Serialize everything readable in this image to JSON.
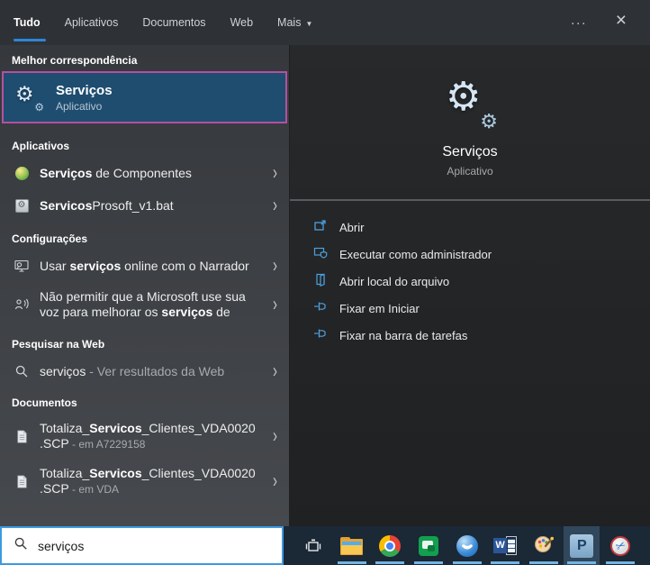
{
  "tabs": [
    {
      "label": "Tudo",
      "active": true
    },
    {
      "label": "Aplicativos",
      "active": false
    },
    {
      "label": "Documentos",
      "active": false
    },
    {
      "label": "Web",
      "active": false
    },
    {
      "label": "Mais",
      "active": false,
      "has_dropdown": true
    }
  ],
  "icons": {
    "gear": "⚙",
    "chevron": "›",
    "more": "···",
    "close": "×",
    "dropdown": "▼",
    "word_letter": "W",
    "prosoft_letter": "P",
    "scissors": "✂",
    "bat_gear": "⚙"
  },
  "best_match": {
    "header": "Melhor correspondência",
    "title": "Serviços",
    "subtitle": "Aplicativo"
  },
  "apps": {
    "header": "Aplicativos",
    "items": [
      {
        "bold": "Serviços",
        "rest": " de Componentes"
      },
      {
        "bold": "Servicos",
        "rest": "Prosoft_v1.bat"
      }
    ]
  },
  "settings": {
    "header": "Configurações",
    "items": [
      {
        "pre": "Usar ",
        "bold": "serviços",
        "rest": " online com o Narrador"
      },
      {
        "pre": "Não permitir que a Microsoft use sua voz para melhorar os ",
        "bold": "serviços",
        "rest": " de"
      }
    ]
  },
  "web": {
    "header": "Pesquisar na Web",
    "items": [
      {
        "query": "serviços",
        "rest": " - Ver resultados da Web"
      }
    ]
  },
  "documents": {
    "header": "Documentos",
    "items": [
      {
        "pre": "Totaliza_",
        "bold": "Servicos",
        "rest": "_Clientes_VDA0020.SCP",
        "suffix": " - em A7229158"
      },
      {
        "pre": "Totaliza_",
        "bold": "Servicos",
        "rest": "_Clientes_VDA0020.SCP",
        "suffix": " - em VDA"
      }
    ]
  },
  "preview": {
    "title": "Serviços",
    "subtitle": "Aplicativo",
    "actions": [
      {
        "label": "Abrir",
        "icon": "open-window-icon"
      },
      {
        "label": "Executar como administrador",
        "icon": "admin-shield-icon"
      },
      {
        "label": "Abrir local do arquivo",
        "icon": "file-location-icon"
      },
      {
        "label": "Fixar em Iniciar",
        "icon": "pin-icon"
      },
      {
        "label": "Fixar na barra de tarefas",
        "icon": "pin-icon"
      }
    ]
  },
  "search": {
    "value": "serviços"
  },
  "taskbar": {
    "items": [
      "task-view",
      "file-explorer",
      "chrome",
      "google-chat",
      "phone",
      "word",
      "paint",
      "prosoft",
      "snipping-tool"
    ]
  },
  "colors": {
    "accent_blue": "#2f86d7",
    "selection_bg": "#1e4d70",
    "selection_border": "#b5509f",
    "action_icon_blue": "#4f9fdc",
    "running_indicator": "#72b4e4",
    "search_border": "#3d9ae1"
  }
}
